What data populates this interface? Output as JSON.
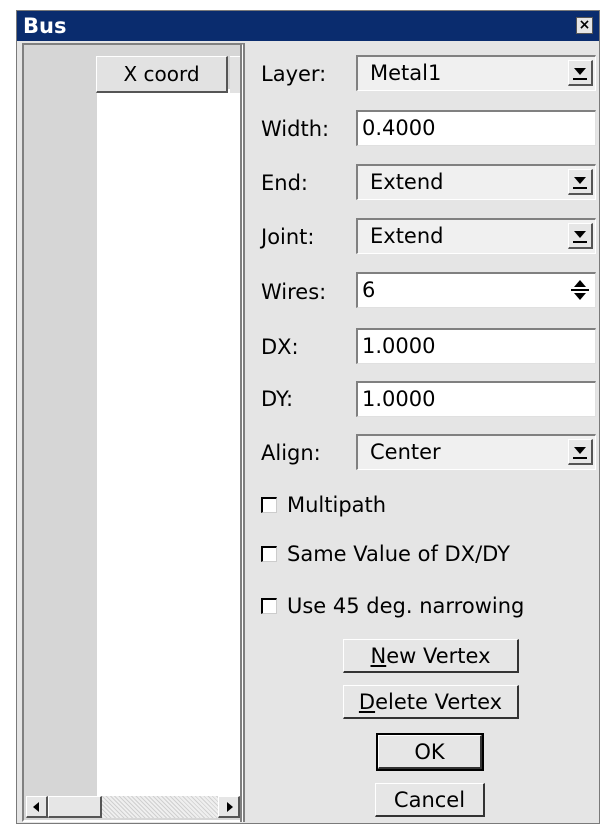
{
  "window": {
    "title": "Bus",
    "close_glyph": "×"
  },
  "list": {
    "column_header": "X coord",
    "rows": []
  },
  "form": {
    "layer_label": "Layer:",
    "layer_value": "Metal1",
    "width_label": "Width:",
    "width_value": "0.4000",
    "end_label": "End:",
    "end_value": "Extend",
    "joint_label": "Joint:",
    "joint_value": "Extend",
    "wires_label": "Wires:",
    "wires_value": "6",
    "dx_label": "DX:",
    "dx_value": "1.0000",
    "dy_label": "DY:",
    "dy_value": "1.0000",
    "align_label": "Align:",
    "align_value": "Center"
  },
  "checks": {
    "multipath": {
      "label": "Multipath",
      "checked": false
    },
    "same_dxdy": {
      "label": "Same Value of DX/DY",
      "checked": false
    },
    "narrowing": {
      "label": "Use 45 deg. narrowing",
      "checked": false
    }
  },
  "buttons": {
    "new_vertex_mnemonic": "N",
    "new_vertex_rest": "ew Vertex",
    "delete_vertex_mnemonic": "D",
    "delete_vertex_rest": "elete Vertex",
    "ok": "OK",
    "cancel": "Cancel"
  },
  "colors": {
    "titlebar": "#0a2c6e",
    "window_bg": "#e5e5e5"
  }
}
